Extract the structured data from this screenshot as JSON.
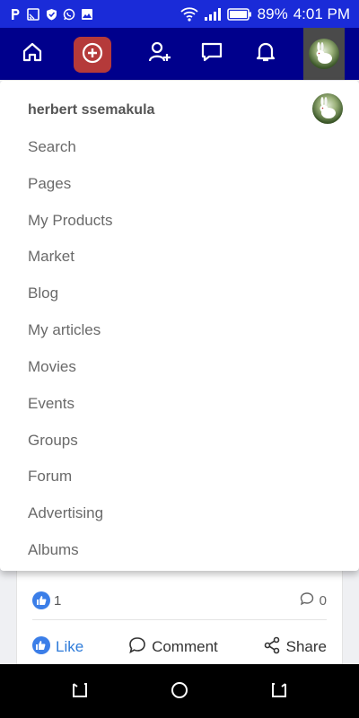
{
  "status_bar": {
    "left_icons": [
      "parking-icon",
      "screencast-icon",
      "shield-icon",
      "whatsapp-icon",
      "gallery-icon"
    ],
    "battery": "89%",
    "time": "4:01 PM"
  },
  "nav": {
    "items": [
      "home-icon",
      "create-plus-icon",
      "add-friend-icon",
      "messages-icon",
      "notifications-icon",
      "profile-avatar"
    ]
  },
  "dropdown": {
    "username": "herbert ssemakula",
    "items": [
      "Search",
      "Pages",
      "My Products",
      "Market",
      "Blog",
      "My articles",
      "Movies",
      "Events",
      "Groups",
      "Forum",
      "Advertising",
      "Albums"
    ]
  },
  "post": {
    "like_count": "1",
    "comment_count": "0",
    "actions": {
      "like": "Like",
      "comment": "Comment",
      "share": "Share"
    }
  },
  "colors": {
    "status_bar": "#1a2bd8",
    "nav_bar": "#00008c",
    "create_button": "#b53a3a",
    "like_blue": "#2e7bd9"
  }
}
